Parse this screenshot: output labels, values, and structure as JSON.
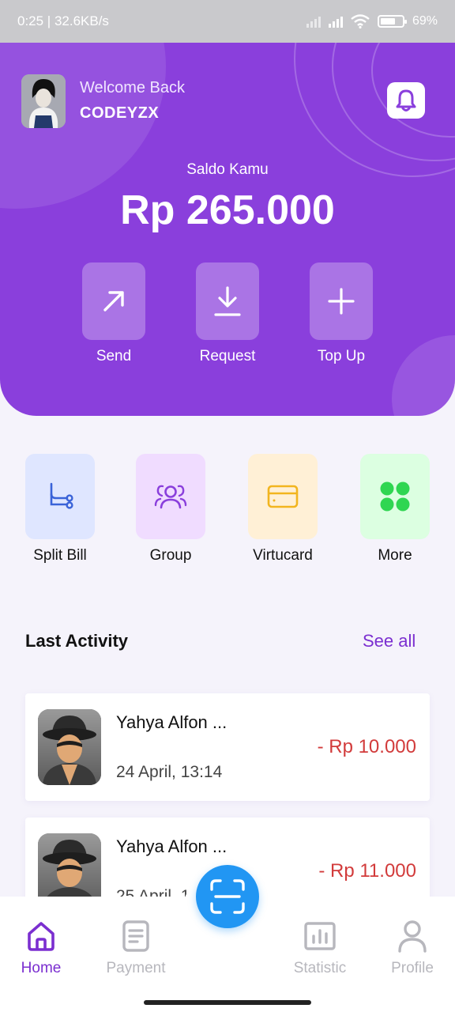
{
  "status_bar": {
    "time_speed": "0:25 | 32.6KB/s",
    "battery": "69%"
  },
  "header": {
    "welcome": "Welcome Back",
    "username": "CODEYZX",
    "balance_label": "Saldo Kamu",
    "balance_value": "Rp 265.000"
  },
  "actions": [
    {
      "label": "Send",
      "icon": "arrow-up-right-icon"
    },
    {
      "label": "Request",
      "icon": "download-icon"
    },
    {
      "label": "Top Up",
      "icon": "plus-icon"
    }
  ],
  "features": [
    {
      "label": "Split Bill",
      "icon": "split-bill-icon",
      "bg": "#dfe6ff",
      "color": "#3a63d8"
    },
    {
      "label": "Group",
      "icon": "group-icon",
      "bg": "#f0dcff",
      "color": "#8a3fdc"
    },
    {
      "label": "Virtucard",
      "icon": "card-icon",
      "bg": "#fff0d6",
      "color": "#f2b51f"
    },
    {
      "label": "More",
      "icon": "grid-dots-icon",
      "bg": "#dcffe1",
      "color": "#2fd651"
    }
  ],
  "last_activity": {
    "title": "Last Activity",
    "see_all": "See all",
    "items": [
      {
        "name": "Yahya Alfon ...",
        "date": "24 April,  13:14",
        "amount": "- Rp 10.000"
      },
      {
        "name": "Yahya Alfon ...",
        "date": "25 April,  1",
        "amount": "- Rp 11.000"
      }
    ]
  },
  "nav": {
    "home": "Home",
    "payment": "Payment",
    "statistic": "Statistic",
    "profile": "Profile"
  },
  "colors": {
    "primary": "#8a3fdc",
    "accent_text": "#7b2fd0",
    "negative_amount": "#d23b3b",
    "scan_button": "#2196f3"
  }
}
